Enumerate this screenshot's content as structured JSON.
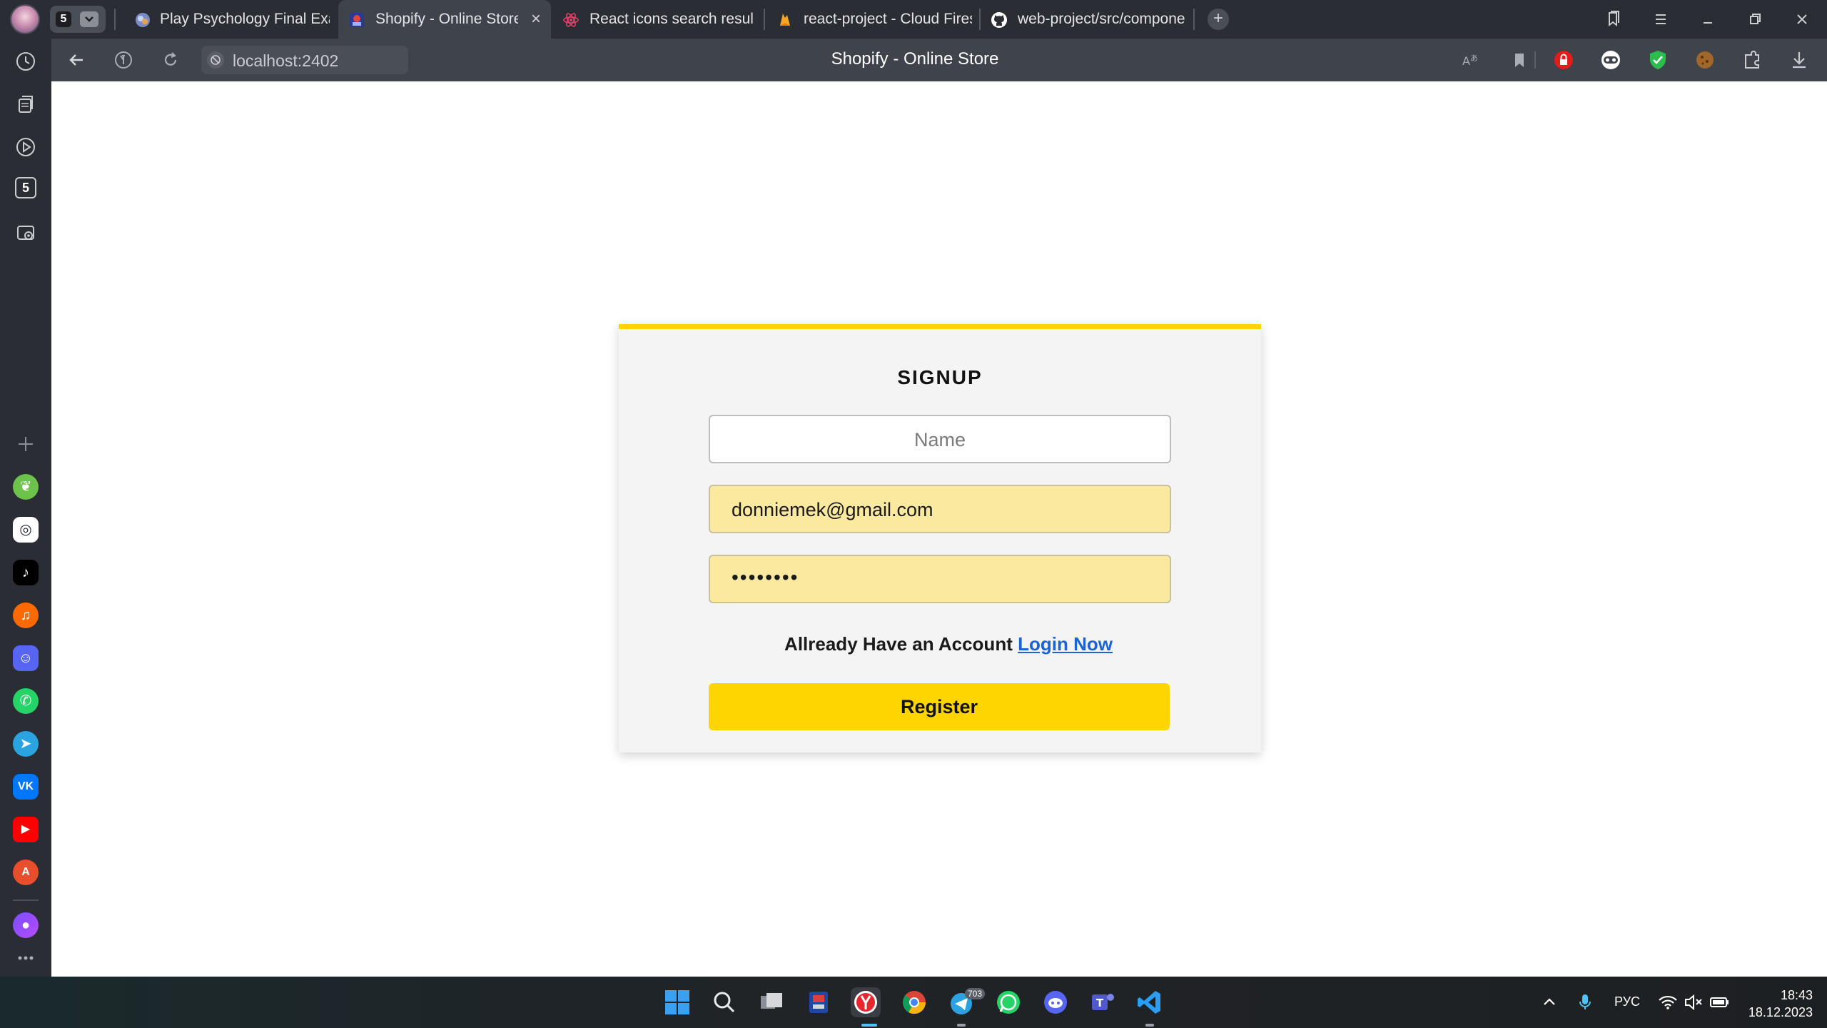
{
  "browser": {
    "tabgroup_count": "5",
    "tabs": [
      {
        "title": "Play Psychology Final Exam",
        "active": false
      },
      {
        "title": "Shopify - Online Store",
        "active": true
      },
      {
        "title": "React icons search results",
        "active": false
      },
      {
        "title": "react-project - Cloud Firest",
        "active": false
      },
      {
        "title": "web-project/src/componen",
        "active": false
      }
    ],
    "close_glyph": "×",
    "new_tab_glyph": "+",
    "url": "localhost:2402",
    "page_title": "Shopify - Online Store",
    "side_badge": "5"
  },
  "signup": {
    "heading": "SIGNUP",
    "name_placeholder": "Name",
    "email_value": "donniemek@gmail.com",
    "password_mask": "••••••••",
    "account_prompt": "Allready Have an Account",
    "login_link": "Login Now",
    "register_label": "Register"
  },
  "taskbar": {
    "telegram_badge": "703",
    "language": "РУС",
    "time": "18:43",
    "date": "18.12.2023"
  },
  "colors": {
    "accent_yellow": "#ffd500",
    "autofill_yellow": "#fce9a0",
    "link_blue": "#1a63d6",
    "browser_dark": "#2a2d33"
  }
}
